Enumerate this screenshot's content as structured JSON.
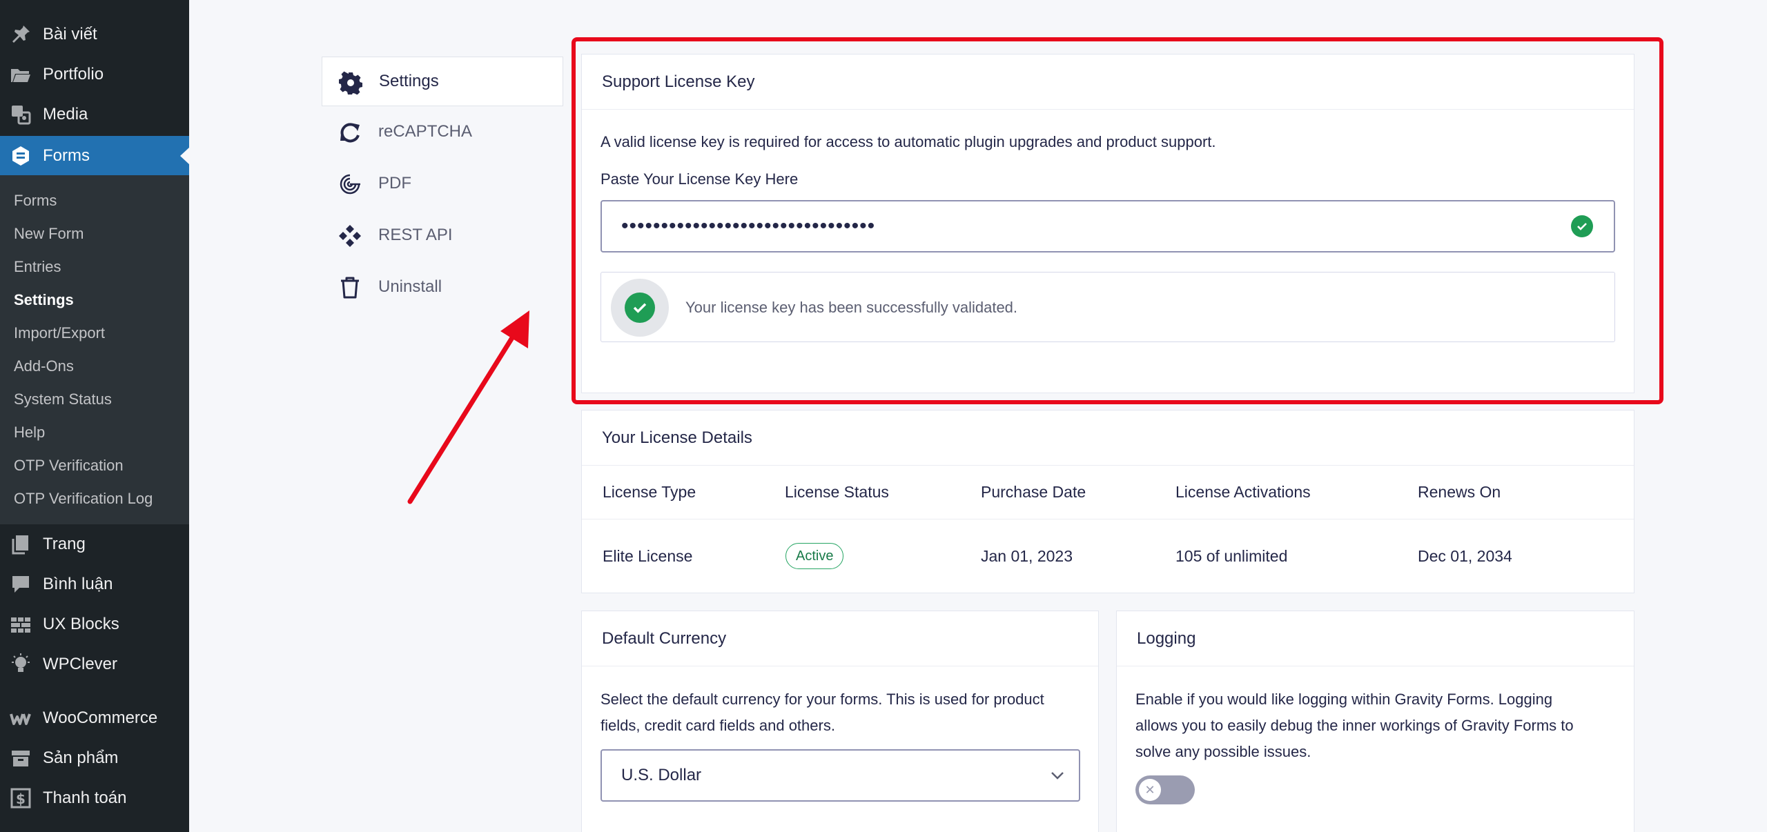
{
  "sidebar": {
    "top_items": [
      {
        "label": "Bài viết",
        "icon": "pin-icon"
      },
      {
        "label": "Portfolio",
        "icon": "folder-icon"
      },
      {
        "label": "Media",
        "icon": "media-icon"
      },
      {
        "label": "Forms",
        "icon": "gravity-forms-icon"
      }
    ],
    "submenu": [
      "Forms",
      "New Form",
      "Entries",
      "Settings",
      "Import/Export",
      "Add-Ons",
      "System Status",
      "Help",
      "OTP Verification",
      "OTP Verification Log"
    ],
    "bottom_items": [
      {
        "label": "Trang",
        "icon": "page-icon"
      },
      {
        "label": "Bình luận",
        "icon": "comment-icon"
      },
      {
        "label": "UX Blocks",
        "icon": "blocks-icon"
      },
      {
        "label": "WPClever",
        "icon": "bulb-icon"
      },
      {
        "label": "WooCommerce",
        "icon": "woocommerce-icon"
      },
      {
        "label": "Sản phẩm",
        "icon": "archive-icon"
      },
      {
        "label": "Thanh toán",
        "icon": "dollar-icon"
      }
    ]
  },
  "settings_nav": [
    "Settings",
    "reCAPTCHA",
    "PDF",
    "REST API",
    "Uninstall"
  ],
  "license": {
    "title": "Support License Key",
    "description": "A valid license key is required for access to automatic plugin upgrades and product support.",
    "label": "Paste Your License Key Here",
    "masked_value": "••••••••••••••••••••••••••••••••",
    "success_message": "Your license key has been successfully validated."
  },
  "details": {
    "title": "Your License Details",
    "headers": [
      "License Type",
      "License Status",
      "Purchase Date",
      "License Activations",
      "Renews On"
    ],
    "row": {
      "type": "Elite License",
      "status": "Active",
      "purchase_date": "Jan 01, 2023",
      "activations": "105 of unlimited",
      "renews_on": "Dec 01, 2034"
    }
  },
  "currency": {
    "title": "Default Currency",
    "description_1": "Select the default currency for your forms. This is used for product",
    "description_2": "fields, credit card fields and others.",
    "selected": "U.S. Dollar"
  },
  "logging": {
    "title": "Logging",
    "description_1": "Enable if you would like logging within Gravity Forms. Logging",
    "description_2": "allows you to easily debug the inner workings of Gravity Forms to",
    "description_3": "solve any possible issues.",
    "enabled": false,
    "toggle_symbol": "✕"
  },
  "colors": {
    "accent": "#2271b1",
    "success": "#1f9d55",
    "annotation": "#e8091b",
    "sidebar_bg": "#1d2327"
  }
}
